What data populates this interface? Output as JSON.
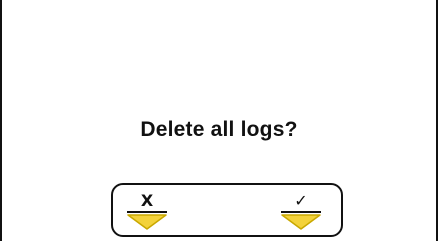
{
  "dialog": {
    "message": "Delete all logs?"
  },
  "softkeys": {
    "cancel": {
      "label": "X"
    },
    "confirm": {
      "label": "✓"
    }
  },
  "colors": {
    "background": "#ffffff",
    "text": "#111111",
    "arrow_fill": "#f3d23a",
    "arrow_stroke": "#c9a800"
  },
  "icons": {
    "cancel_arrow": "down-arrow-icon",
    "confirm_arrow": "down-arrow-icon"
  }
}
